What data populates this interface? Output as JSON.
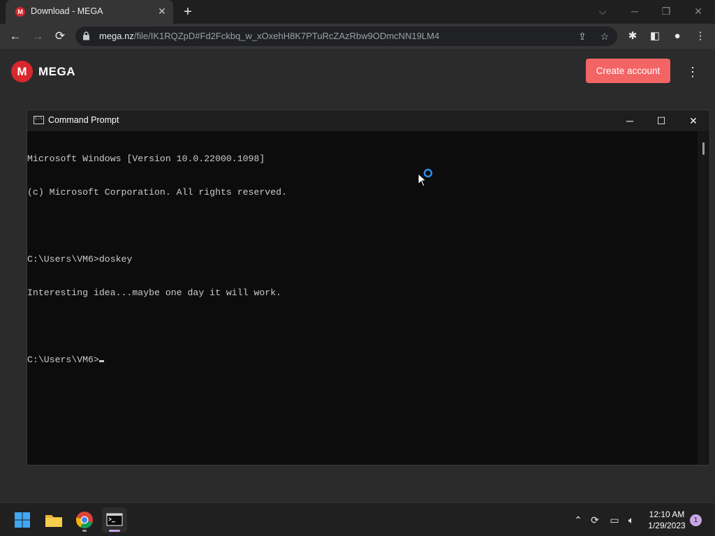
{
  "browser": {
    "tab_title": "Download - MEGA",
    "tab_favicon": "M",
    "url_host": "mega.nz",
    "url_path": "/file/IK1RQZpD#Fd2Fckbq_w_xOxehH8K7PTuRcZAzRbw9ODmcNN19LM4"
  },
  "mega": {
    "logo_letter": "M",
    "brand": "MEGA",
    "create_account": "Create account"
  },
  "cmd": {
    "title": "Command Prompt",
    "lines": [
      "Microsoft Windows [Version 10.0.22000.1098]",
      "(c) Microsoft Corporation. All rights reserved.",
      "",
      "C:\\Users\\VM6>doskey",
      "Interesting idea...maybe one day it will work.",
      ""
    ],
    "prompt": "C:\\Users\\VM6>"
  },
  "taskbar": {
    "time": "12:10 AM",
    "date": "1/29/2023",
    "notification_count": "1"
  },
  "colors": {
    "mega_red": "#d9272e",
    "create_button": "#f36565",
    "cmd_bg": "#0c0c0c",
    "notif_badge": "#c8a6e6"
  }
}
